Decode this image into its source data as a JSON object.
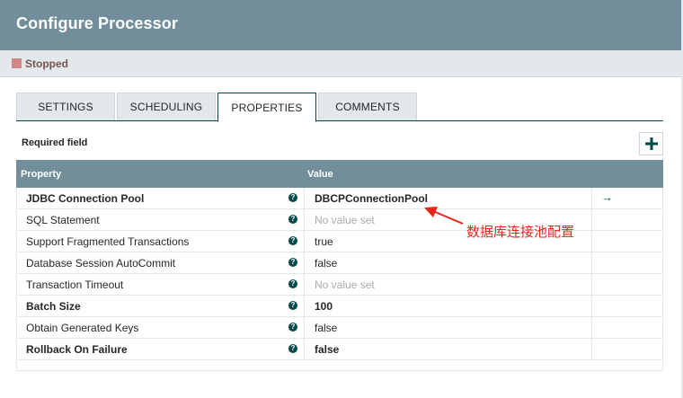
{
  "dialog": {
    "title": "Configure Processor",
    "status": "Stopped"
  },
  "tabs": [
    {
      "label": "SETTINGS",
      "active": false
    },
    {
      "label": "SCHEDULING",
      "active": false
    },
    {
      "label": "PROPERTIES",
      "active": true
    },
    {
      "label": "COMMENTS",
      "active": false
    }
  ],
  "properties": {
    "required_field_label": "Required field",
    "add_icon": "plus-icon",
    "columns": {
      "property": "Property",
      "value": "Value"
    },
    "rows": [
      {
        "name": "JDBC Connection Pool",
        "required": true,
        "value": "DBCPConnectionPool",
        "value_set": true,
        "has_goto": true
      },
      {
        "name": "SQL Statement",
        "required": false,
        "value": "No value set",
        "value_set": false,
        "has_goto": false
      },
      {
        "name": "Support Fragmented Transactions",
        "required": false,
        "value": "true",
        "value_set": true,
        "has_goto": false
      },
      {
        "name": "Database Session AutoCommit",
        "required": false,
        "value": "false",
        "value_set": true,
        "has_goto": false
      },
      {
        "name": "Transaction Timeout",
        "required": false,
        "value": "No value set",
        "value_set": false,
        "has_goto": false
      },
      {
        "name": "Batch Size",
        "required": true,
        "value": "100",
        "value_set": true,
        "has_goto": false
      },
      {
        "name": "Obtain Generated Keys",
        "required": false,
        "value": "false",
        "value_set": true,
        "has_goto": false
      },
      {
        "name": "Rollback On Failure",
        "required": true,
        "value": "false",
        "value_set": true,
        "has_goto": false
      }
    ],
    "help_icon": "question-icon",
    "goto_icon": "arrow-right-icon"
  },
  "annotation": {
    "text": "数据库连接池配置",
    "color": "#e8241b"
  },
  "colors": {
    "header": "#728e9b",
    "accent": "#004849",
    "status_stopped": "#d18686"
  }
}
